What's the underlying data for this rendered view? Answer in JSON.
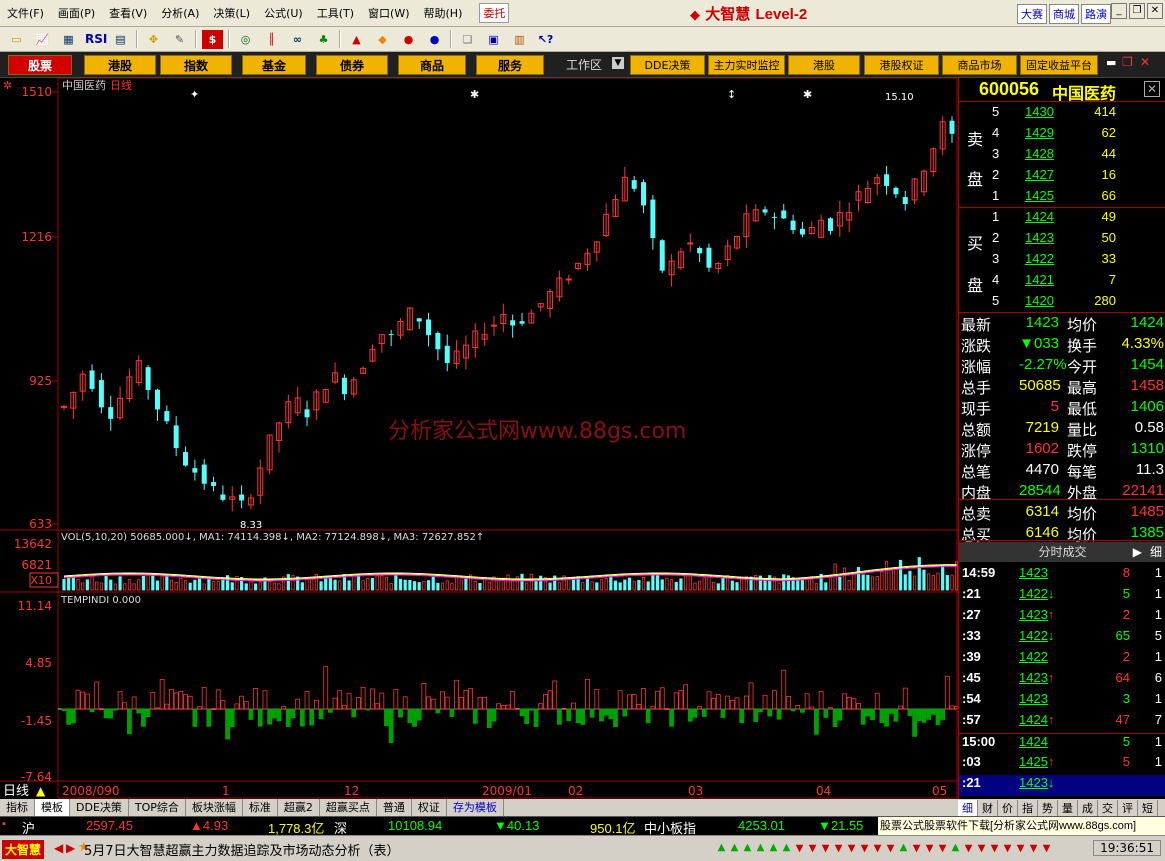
{
  "menu": {
    "items": [
      "文件(F)",
      "画面(P)",
      "查看(V)",
      "分析(A)",
      "决策(L)",
      "公式(U)",
      "工具(T)",
      "窗口(W)",
      "帮助(H)"
    ],
    "weituo": "委托",
    "brand": "大智慧",
    "brand_level": "Level-2",
    "right_links": [
      "大赛",
      "商城",
      "路演"
    ]
  },
  "toolbar": {
    "icons": [
      "folder-icon",
      "line-chart-icon",
      "grid-icon",
      "rsi-icon",
      "table-icon",
      "move-icon",
      "ruler-icon",
      "dollar-icon",
      "ticker-icon",
      "bars-icon",
      "binoculars-icon",
      "alert-icon",
      "warning-icon",
      "diamond-icon",
      "red-circle-icon",
      "blue-circle-icon",
      "copy-icon",
      "window-icon",
      "books-icon",
      "help-cursor-icon"
    ],
    "rsi_label": "RSI",
    "dollar_label": "$"
  },
  "nav": {
    "buttons": [
      "股票",
      "港股",
      "指数",
      "基金",
      "债券",
      "商品",
      "服务"
    ],
    "workarea": "工作区",
    "right_buttons": [
      "DDE决策",
      "主力实时监控",
      "港股",
      "港股权证",
      "商品市场",
      "固定收益平台"
    ]
  },
  "chart": {
    "stock_name": "中国医药",
    "period": "日线",
    "price_axis": [
      "1510",
      "1216",
      "925",
      "633"
    ],
    "min_label": "8.33",
    "max_label": "15.10",
    "watermark": "分析家公式网www.88gs.com",
    "vol_header": "VOL(5,10,20) 50685.000↓, MA1: 74114.398↓, MA2: 77124.898↓, MA3: 72627.852↑",
    "vol_axis": [
      "13642",
      "6821",
      "X10"
    ],
    "ind_header": "TEMPINDI 0.000",
    "ind_axis": [
      "11.14",
      "4.85",
      "-1.45",
      "-7.64"
    ],
    "date_axis": [
      "2008/090",
      "1",
      "12",
      "2009/01",
      "02",
      "03",
      "04",
      "05"
    ],
    "period_tag": "日线"
  },
  "chart_data": {
    "type": "candlestick",
    "title": "中国医药 日线",
    "ylim": [
      633,
      1510
    ],
    "trend": [
      870,
      900,
      940,
      920,
      880,
      860,
      890,
      930,
      950,
      910,
      870,
      830,
      790,
      760,
      740,
      720,
      700,
      690,
      680,
      670,
      700,
      750,
      800,
      840,
      870,
      880,
      860,
      890,
      920,
      930,
      910,
      930,
      960,
      1000,
      1020,
      1010,
      1040,
      1060,
      1050,
      1020,
      990,
      960,
      970,
      990,
      1010,
      1030,
      1040,
      1060,
      1040,
      1050,
      1060,
      1080,
      1100,
      1120,
      1140,
      1160,
      1190,
      1220,
      1260,
      1300,
      1330,
      1320,
      1280,
      1200,
      1150,
      1160,
      1190,
      1200,
      1180,
      1150,
      1160,
      1190,
      1220,
      1250,
      1260,
      1270,
      1260,
      1250,
      1240,
      1220,
      1230,
      1250,
      1240,
      1260,
      1280,
      1300,
      1320,
      1340,
      1330,
      1310,
      1290,
      1320,
      1360,
      1400,
      1440,
      1420
    ]
  },
  "quote": {
    "code": "600056",
    "name": "中国医药",
    "sell_label": [
      "卖",
      "盘"
    ],
    "buy_label": [
      "买",
      "盘"
    ],
    "sell": [
      {
        "lv": "5",
        "price": "1430",
        "vol": "414"
      },
      {
        "lv": "4",
        "price": "1429",
        "vol": "62"
      },
      {
        "lv": "3",
        "price": "1428",
        "vol": "44"
      },
      {
        "lv": "2",
        "price": "1427",
        "vol": "16"
      },
      {
        "lv": "1",
        "price": "1425",
        "vol": "66"
      }
    ],
    "buy": [
      {
        "lv": "1",
        "price": "1424",
        "vol": "49"
      },
      {
        "lv": "2",
        "price": "1423",
        "vol": "50"
      },
      {
        "lv": "3",
        "price": "1422",
        "vol": "33"
      },
      {
        "lv": "4",
        "price": "1421",
        "vol": "7"
      },
      {
        "lv": "5",
        "price": "1420",
        "vol": "280"
      }
    ],
    "stats": [
      {
        "k": "最新",
        "v": "1423",
        "vc": "#00ff00",
        "k2": "均价",
        "v2": "1424",
        "v2c": "#00ff00"
      },
      {
        "k": "涨跌",
        "v": "▼033",
        "vc": "#00ff00",
        "k2": "换手",
        "v2": "4.33%",
        "v2c": "#ffff00"
      },
      {
        "k": "涨幅",
        "v": "-2.27%",
        "vc": "#00ff00",
        "k2": "今开",
        "v2": "1454",
        "v2c": "#00ff00"
      },
      {
        "k": "总手",
        "v": "50685",
        "vc": "#ffff00",
        "k2": "最高",
        "v2": "1458",
        "v2c": "#ff3333"
      },
      {
        "k": "现手",
        "v": "5",
        "vc": "#ff3333",
        "k2": "最低",
        "v2": "1406",
        "v2c": "#00ff00"
      },
      {
        "k": "总额",
        "v": "7219",
        "vc": "#ffff00",
        "k2": "量比",
        "v2": "0.58",
        "v2c": "#ffffff"
      },
      {
        "k": "涨停",
        "v": "1602",
        "vc": "#ff3333",
        "k2": "跌停",
        "v2": "1310",
        "v2c": "#00ff00"
      },
      {
        "k": "总笔",
        "v": "4470",
        "vc": "#ffffff",
        "k2": "每笔",
        "v2": "11.3",
        "v2c": "#ffffff"
      },
      {
        "k": "内盘",
        "v": "28544",
        "vc": "#00ff00",
        "k2": "外盘",
        "v2": "22141",
        "v2c": "#ff3333"
      },
      {
        "k": "总卖",
        "v": "6314",
        "vc": "#ffff00",
        "k2": "均价",
        "v2": "1485",
        "v2c": "#ff3333"
      },
      {
        "k": "总买",
        "v": "6146",
        "vc": "#ffff00",
        "k2": "均价",
        "v2": "1385",
        "v2c": "#00ff00"
      }
    ],
    "trades_title": "分时成交",
    "trades_arrow": "▶",
    "trades_tab": "细",
    "trades": [
      {
        "t": "14:59",
        "p": "1423",
        "a": "",
        "q": "8",
        "qc": "#ff3333",
        "n": "1"
      },
      {
        "t": ":21",
        "p": "1422",
        "a": "↓",
        "q": "5",
        "qc": "#00ff00",
        "n": "1"
      },
      {
        "t": ":27",
        "p": "1423",
        "a": "↑",
        "q": "2",
        "qc": "#ff3333",
        "n": "1"
      },
      {
        "t": ":33",
        "p": "1422",
        "a": "↓",
        "q": "65",
        "qc": "#00ff00",
        "n": "5"
      },
      {
        "t": ":39",
        "p": "1422",
        "a": "",
        "q": "2",
        "qc": "#ff3333",
        "n": "1"
      },
      {
        "t": ":45",
        "p": "1423",
        "a": "↑",
        "q": "64",
        "qc": "#ff3333",
        "n": "6"
      },
      {
        "t": ":54",
        "p": "1423",
        "a": "",
        "q": "3",
        "qc": "#00ff00",
        "n": "1"
      },
      {
        "t": ":57",
        "p": "1424",
        "a": "↑",
        "q": "47",
        "qc": "#ff3333",
        "n": "7"
      },
      {
        "t": "15:00",
        "p": "1424",
        "a": "",
        "q": "5",
        "qc": "#00ff00",
        "n": "1"
      },
      {
        "t": ":03",
        "p": "1425",
        "a": "↑",
        "q": "5",
        "qc": "#ff3333",
        "n": "1"
      },
      {
        "t": ":21",
        "p": "1423",
        "a": "↓",
        "q": "",
        "qc": "#00ff00",
        "n": ""
      }
    ]
  },
  "bottom_tabs": [
    "指标",
    "模板",
    "DDE决策",
    "TOP综合",
    "板块涨幅",
    "标准",
    "超赢2",
    "超赢买点",
    "普通",
    "权证",
    "存为模板"
  ],
  "right_tabs": [
    "细",
    "财",
    "价",
    "指",
    "势",
    "量",
    "成",
    "交",
    "评",
    "短"
  ],
  "index_bar": {
    "sh_label": "沪",
    "sh_value": "2597.45",
    "sh_change": "▲4.93",
    "sh_amount": "1,778.3亿",
    "sz_label": "深",
    "sz_value": "10108.94",
    "sz_change": "▼40.13",
    "sz_amount": "950.1亿",
    "sme_label": "中小板指",
    "sme_value": "4253.01",
    "sme_change": "▼21.55",
    "ad_text": "股票公式股票软件下载[分析家公式网www.88gs.com]"
  },
  "status": {
    "brand": "大智慧",
    "news": "5月7日大智慧超赢主力数据追踪及市场动态分析（表）",
    "time": "19:36:51"
  }
}
